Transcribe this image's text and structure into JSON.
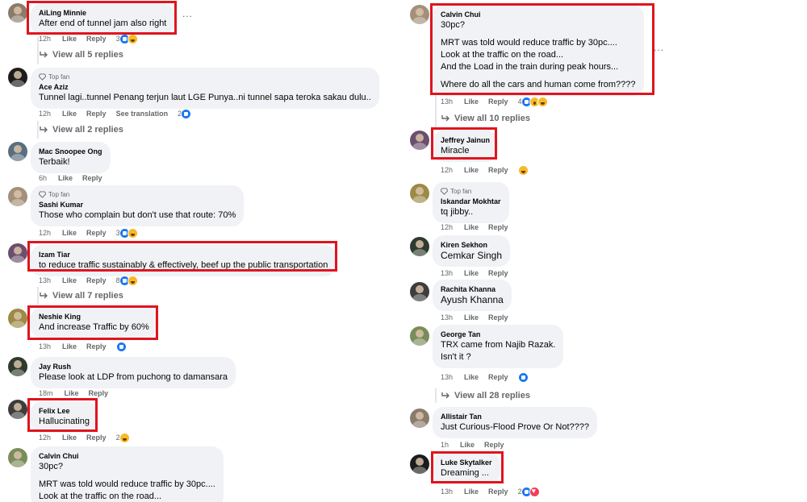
{
  "labels": {
    "like": "Like",
    "reply": "Reply",
    "see_translation": "See translation",
    "top_fan": "Top fan",
    "more": "..."
  },
  "left": [
    {
      "name": "AiLing Minnie",
      "lines": [
        "After end of tunnel jam also right"
      ],
      "time": "12h",
      "reaction_count": "3",
      "reactions": [
        "like",
        "haha"
      ],
      "replies": "View all 5 replies",
      "highlighted": true
    },
    {
      "name": "Ace Aziz",
      "top_fan": true,
      "lines": [
        "Tunnel lagi..tunnel Penang terjun laut LGE Punya..ni tunnel sapa teroka sakau dulu.."
      ],
      "time": "12h",
      "translation": true,
      "reaction_count": "2",
      "reactions": [
        "like"
      ],
      "replies": "View all 2 replies"
    },
    {
      "name": "Mac Snoopee Ong",
      "lines": [
        "Terbaik!"
      ],
      "time": "6h",
      "reactions": []
    },
    {
      "name": "Sashi Kumar",
      "top_fan": true,
      "lines": [
        "Those who complain but don't use that route: 70%"
      ],
      "time": "12h",
      "reaction_count": "3",
      "reactions": [
        "like",
        "haha"
      ]
    },
    {
      "name": "Izam Tiar",
      "lines": [
        "to reduce traffic sustainably & effectively, beef up the public transportation"
      ],
      "time": "13h",
      "reaction_count": "8",
      "reactions": [
        "like",
        "haha"
      ],
      "replies": "View all 7 replies",
      "highlighted": true
    },
    {
      "name": "Neshie King",
      "lines": [
        "And increase Traffic by 60%"
      ],
      "time": "13h",
      "reactions": [
        "like"
      ],
      "highlighted": true
    },
    {
      "name": "Jay Rush",
      "lines": [
        "Please look at LDP from puchong to damansara"
      ],
      "time": "18m",
      "reactions": []
    },
    {
      "name": "Felix Lee",
      "lines": [
        "Hallucinating"
      ],
      "time": "12h",
      "reaction_count": "2",
      "reactions": [
        "haha"
      ],
      "highlighted": true
    },
    {
      "name": "Calvin Chui",
      "lines": [
        "30pc?",
        "",
        "MRT was told would reduce traffic by 30pc....",
        "Look at the traffic on the road..."
      ],
      "time": "",
      "reactions": []
    }
  ],
  "right": [
    {
      "name": "Calvin Chui",
      "lines": [
        "30pc?",
        "",
        "MRT was told would reduce traffic by 30pc....",
        "Look at the traffic on the road...",
        "And the Load in the train during peak hours...",
        "",
        "Where do all the cars and human come from????"
      ],
      "time": "13h",
      "reaction_count": "4",
      "reactions": [
        "like",
        "wow",
        "haha"
      ],
      "replies": "View all 10 replies",
      "highlighted": true
    },
    {
      "name": "Jeffrey Jainun",
      "lines": [
        "Miracle"
      ],
      "time": "12h",
      "reactions": [
        "haha"
      ],
      "highlighted": true
    },
    {
      "name": "Iskandar Mokhtar",
      "top_fan": true,
      "lines": [
        "tq jibby.."
      ],
      "time": "12h",
      "reactions": []
    },
    {
      "name": "Kiren Sekhon",
      "lines": [
        "Cemkar Singh"
      ],
      "big": true,
      "time": "13h",
      "reactions": []
    },
    {
      "name": "Rachita Khanna",
      "lines": [
        "Ayush Khanna"
      ],
      "big": true,
      "time": "13h",
      "reactions": []
    },
    {
      "name": "George Tan",
      "lines": [
        "TRX came from Najib Razak.",
        "Isn't it ?"
      ],
      "time": "13h",
      "reactions": [
        "like"
      ],
      "replies": "View all 28 replies"
    },
    {
      "name": "Allistair Tan",
      "lines": [
        "Just Curious-Flood Prove Or Not????"
      ],
      "time": "1h",
      "reactions": []
    },
    {
      "name": "Luke Skytalker",
      "lines": [
        "Dreaming ..."
      ],
      "time": "13h",
      "reaction_count": "2",
      "reactions": [
        "like",
        "love"
      ],
      "highlighted": true
    }
  ],
  "colors": {
    "bubble": "#f0f2f5",
    "meta_text": "#65676b",
    "highlight": "#e0141e",
    "like_blue": "#1877f2",
    "haha_yellow": "#f7b928",
    "love_red": "#f33e58"
  }
}
